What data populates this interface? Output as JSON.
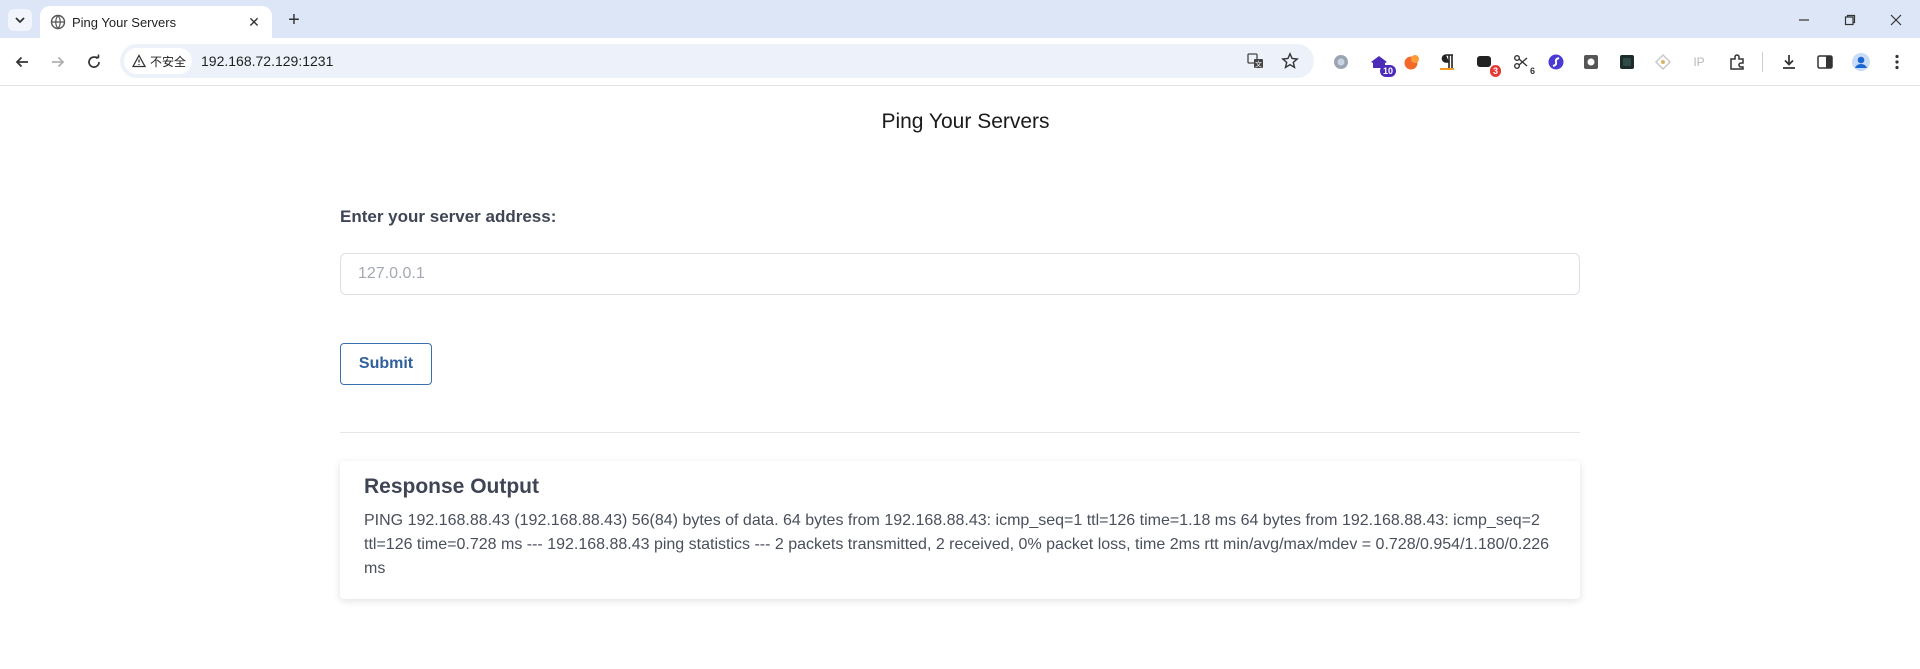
{
  "browser": {
    "tab_title": "Ping Your Servers",
    "security_label": "不安全",
    "url": "192.168.72.129:1231",
    "extensions": [
      {
        "icon": "gray-circle-icon",
        "badge": ""
      },
      {
        "icon": "purple-hat-icon",
        "badge": "10",
        "badge_color": "#4b2bb8"
      },
      {
        "icon": "orange-blob-icon",
        "badge": ""
      },
      {
        "icon": "pilcrow-icon",
        "badge": ""
      },
      {
        "icon": "chat-icon",
        "badge": "3",
        "badge_color": "#e53935"
      },
      {
        "icon": "scissors-icon",
        "badge": "6",
        "badge_color": "#555555"
      },
      {
        "icon": "blue-swirl-icon",
        "badge": ""
      },
      {
        "icon": "camera-icon",
        "badge": ""
      },
      {
        "icon": "dark-square-icon",
        "badge": ""
      },
      {
        "icon": "diamond-icon",
        "badge": ""
      },
      {
        "icon": "ip-icon",
        "badge": "",
        "label": "IP"
      },
      {
        "icon": "puzzle-icon",
        "badge": ""
      }
    ]
  },
  "page": {
    "title": "Ping Your Servers",
    "form": {
      "label": "Enter your server address:",
      "placeholder": "127.0.0.1",
      "value": "",
      "submit_label": "Submit"
    },
    "output": {
      "heading": "Response Output",
      "text": "PING 192.168.88.43 (192.168.88.43) 56(84) bytes of data. 64 bytes from 192.168.88.43: icmp_seq=1 ttl=126 time=1.18 ms 64 bytes from 192.168.88.43: icmp_seq=2 ttl=126 time=0.728 ms --- 192.168.88.43 ping statistics --- 2 packets transmitted, 2 received, 0% packet loss, time 2ms rtt min/avg/max/mdev = 0.728/0.954/1.180/0.226 ms"
    }
  },
  "colors": {
    "chrome_bg": "#dde6f6",
    "accent": "#2f5f9c",
    "label_text": "#3f4555"
  }
}
